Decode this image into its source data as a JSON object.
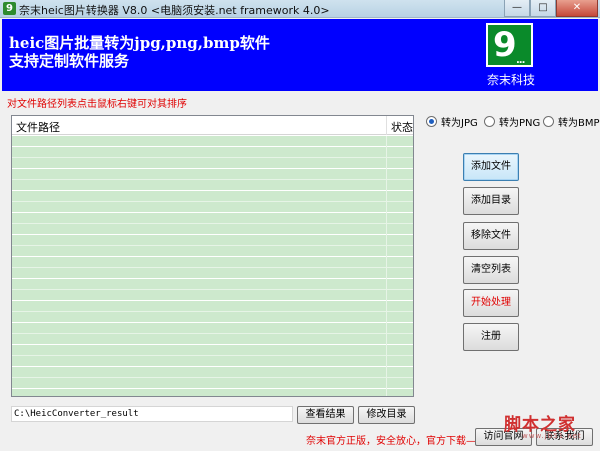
{
  "window": {
    "title": "奈末heic图片转换器 V8.0 <电脑须安装.net framework 4.0>",
    "app_icon_char": "9",
    "controls": {
      "minimize": "—",
      "restore": "□",
      "close": "✕"
    }
  },
  "banner": {
    "line1": "heic图片批量转为jpg,png,bmp软件",
    "line2": "支持定制软件服务",
    "logo_digit": "9",
    "logo_dots": "...",
    "logo_caption": "奈末科技",
    "background": "#0000ff"
  },
  "hint": "对文件路径列表点击鼠标右键可对其排序",
  "list": {
    "columns": [
      "文件路径",
      "状态"
    ],
    "rows": []
  },
  "format_options": [
    {
      "label": "转为JPG",
      "checked": true
    },
    {
      "label": "转为PNG",
      "checked": false
    },
    {
      "label": "转为BMP",
      "checked": false
    }
  ],
  "buttons": {
    "add_file": "添加文件",
    "add_dir": "添加目录",
    "remove_file": "移除文件",
    "clear_list": "清空列表",
    "start": "开始处理",
    "register": "注册",
    "view_result": "查看结果",
    "change_dir": "修改目录",
    "visit_site": "访问官网",
    "contact": "联系我们"
  },
  "output_path": "C:\\HeicConverter_result",
  "footer_notice": "奈末官方正版，安全放心，官方下载——>",
  "watermark": {
    "text": "脚本之家",
    "url": "www.jb51.net"
  },
  "colors": {
    "accent_red": "#e00000",
    "list_green": "#cde9cd"
  }
}
